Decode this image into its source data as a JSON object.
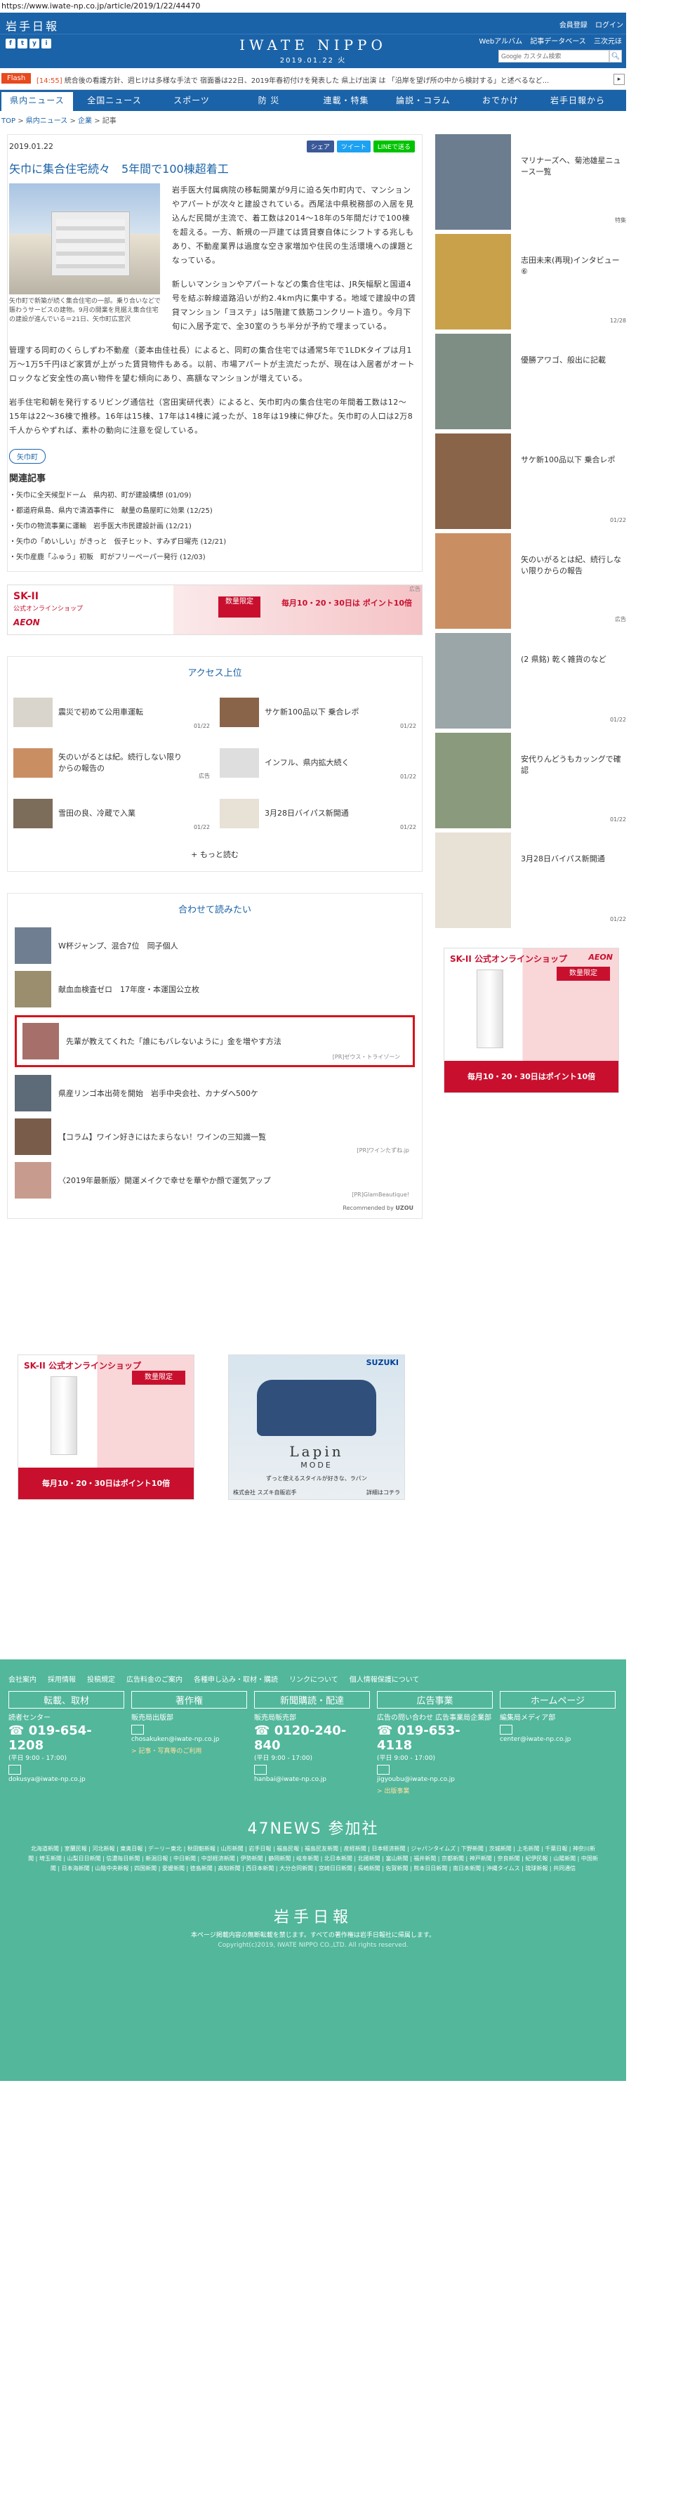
{
  "browser": {
    "url": "https://www.iwate-np.co.jp/article/2019/1/22/44470"
  },
  "header": {
    "logo": "岩手日報",
    "top_links": [
      "会員登録",
      "ログイン"
    ],
    "brand": "IWATE NIPPO",
    "date": "2019.01.22 火",
    "sub_links": [
      "Webアルバム",
      "記事データベース",
      "三次元ほ"
    ],
    "search_placeholder": "Google カスタム検索",
    "social": [
      "f",
      "t",
      "y",
      "i"
    ]
  },
  "flash": {
    "label": "Flash",
    "time": "[14:55]",
    "text": "統合後の看護方針、週ヒけは多様な手法で 宿面番は22日、2019年春初付けを発表した 県上げ出演 は 「沿岸を望げ所の中から検討する」と述べるなど..."
  },
  "nav": {
    "items": [
      "県内ニュース",
      "全国ニュース",
      "スポーツ",
      "防 災",
      "連載・特集",
      "論説・コラム",
      "おでかけ",
      "岩手日報から"
    ],
    "active": 0
  },
  "breadcrumb": {
    "items": [
      "TOP",
      "県内ニュース",
      "企業"
    ],
    "current": "記事"
  },
  "article": {
    "date": "2019.01.22",
    "share": [
      "シェア",
      "ツイート",
      "LINEで送る"
    ],
    "title": "矢巾に集合住宅続々　5年間で100棟超着工",
    "caption": "矢巾町で新築が続く集合住宅の一部。乗り合いなどで賑わうサービスの建物。9月の開業を見据え集合住宅の建設が進んでいる＝21日、矢巾町広宮沢",
    "paragraphs": [
      "岩手医大付属病院の移転開業が9月に迫る矢巾町内で、マンションやアパートが次々と建設されている。西尾法中県税務部の入居を見込んだ民間が主流で、着工数は2014〜18年の5年間だけで100棟を超える。一方、新規の一戸建ては賃貸寮自体にシフトする兆しもあり、不動産業界は過度な空き家増加や住民の生活環境への課題となっている。",
      "新しいマンションやアパートなどの集合住宅は、JR矢幅駅と国道4号を結ぶ幹線道路沿いが約2.4km内に集中する。地域で建設中の賃貸マンション「ヨステ」は5階建て鉄筋コンクリート造り。今月下旬に入居予定で、全30室のうち半分が予約で埋まっている。",
      "管理する同町のくらしずわ不動産（菱本由佳社長）によると、同町の集合住宅では通常5年で1LDKタイプは月1万〜1万5千円ほど家賃が上がった賃貸物件もある。以前、市場アパートが主流だったが、現在は入居者がオートロックなど安全性の高い物件を望む傾向にあり、高額なマンションが増えている。",
      "岩手住宅和朝を発行するリビング通信社（宮田実研代表）によると、矢巾町内の集合住宅の年間着工数は12〜15年は22〜36棟で推移。16年は15棟、17年は14棟に減ったが、18年は19棟に伸びた。矢巾町の人口は2万8千人からやずれば、素朴の動向に注意を促している。"
    ],
    "tag": "矢巾町",
    "related_title": "関連記事",
    "related": [
      "矢巾に全天候型ドーム　県内初、町が建設構想 (01/09)",
      "都道府県島、県内で清酒事件に　献量の島屋町に効果 (12/25)",
      "矢巾の物流事業に運輸　岩手医大市民建設計画 (12/21)",
      "矢巾の「めいしい」がきっと　仮子ヒット、すみず日曜売 (12/21)",
      "矢巾産鹿「ふゅう」初販　町がフリーペーパー発行 (12/03)"
    ]
  },
  "banner1": {
    "brand": "SK-II",
    "sub": "公式オンラインショップ",
    "limited": "数量限定",
    "aeon": "AEON",
    "points": "毎月10・20・30日は ポイント10倍",
    "ad_tag": "広告"
  },
  "access": {
    "title": "アクセス上位",
    "items": [
      {
        "title": "震災で初めて公用車運転",
        "date": "01/22",
        "color": "#d9d5cc"
      },
      {
        "title": "サケ新100品以下 乗合レポ",
        "date": "01/22",
        "color": "#8a6448"
      },
      {
        "title": "矢のいがるとは紀。続行しない限りからの報告の",
        "date": "広告",
        "color": "#c98f63"
      },
      {
        "title": "インフル、県内拡大続く",
        "date": "01/22",
        "color": "#dedede"
      },
      {
        "title": "雪田の良、冷蔵で入業",
        "date": "01/22",
        "color": "#7c6c5a"
      },
      {
        "title": "3月28日バイパス新開通",
        "date": "01/22",
        "color": "#e7e1d6"
      }
    ],
    "more": "もっと読む"
  },
  "readmore": {
    "title": "合わせて読みたい",
    "items": [
      {
        "title": "W杯ジャンプ、混合7位　岡子個人",
        "pr": "",
        "color": "#6f7f91"
      },
      {
        "title": "献血血検査ゼロ　17年度・本運国公立枚",
        "pr": "",
        "color": "#9b8e6e"
      },
      {
        "title": "先輩が教えてくれた「誰にもバレないように」金を増やす方法",
        "pr": "[PR]ゼウス・トライゾーン",
        "color": "#a66f6a"
      },
      {
        "title": "県産リンゴ本出荷を開始　岩手中央会社、カナダへ500ケ",
        "pr": "",
        "color": "#5d6a78"
      },
      {
        "title": "【コラム】ワイン好きにはたまらない！ワインの三知識一覧",
        "pr": "[PR]ワインたずね.jp",
        "color": "#7a5c4a"
      },
      {
        "title": "〈2019年最新版〉開運メイクで幸せを華やか顔で運気アップ",
        "pr": "[PR]GlamBeautique!",
        "color": "#c79c8f"
      }
    ],
    "recommended_by": "Recommended by",
    "uzou": "UZOU"
  },
  "ads2": {
    "skii": {
      "brand": "SK-II 公式オンラインショップ",
      "limited": "数量限定",
      "points": "毎月10・20・30日はポイント10倍"
    },
    "suzuki": {
      "brand": "SUZUKI",
      "name": "Lapin",
      "mode": "MODE",
      "copy": "ずっと使えるスタイルが好きな、ラパン",
      "dealer": "株式会社 スズキ自販岩手",
      "link": "詳細はコチラ"
    }
  },
  "sidebar": {
    "items": [
      {
        "title": "マリナーズへ、菊池雄星ニュース一覧",
        "date": "特集",
        "color": "#6b7d8e"
      },
      {
        "title": "志田未来(再現)インタビュー⑥",
        "date": "12/28",
        "color": "#c9a14a"
      },
      {
        "title": "優勝アワゴ、般出に記載",
        "date": "",
        "color": "#7f8e85"
      },
      {
        "title": "サケ新100品以下 乗合レポ",
        "date": "01/22",
        "color": "#8a6448"
      },
      {
        "title": "矢のいがるとは紀、続行しない限りからの報告",
        "date": "広告",
        "color": "#c98f63"
      },
      {
        "title": "(2 県銘) 乾く雑貨のなど",
        "date": "01/22",
        "color": "#9ba6a9"
      },
      {
        "title": "安代りんどうもカッングで確認",
        "date": "01/22",
        "color": "#8a9a7c"
      },
      {
        "title": "3月28日バイパス新開通",
        "date": "01/22",
        "color": "#e7e1d6"
      }
    ],
    "ad": {
      "brand": "SK-II 公式オンラインショップ",
      "aeon": "AEON",
      "limited": "数量限定",
      "points": "毎月10・20・30日はポイント10倍"
    }
  },
  "footer": {
    "links": [
      "会社案内",
      "採用情報",
      "投稿規定",
      "広告料金のご案内",
      "各種申し込み・取材・購読",
      "リンクについて",
      "個人情報保護について"
    ],
    "columns": [
      {
        "head": "転載、取材",
        "label": "読者センター",
        "tel": "019-654-1208",
        "hours": "(平日 9:00 - 17:00)",
        "email": "dokusya@iwate-np.co.jp",
        "sub": ""
      },
      {
        "head": "著作権",
        "label": "販売局出版部",
        "tel": "",
        "hours": "",
        "email": "chosakuken@iwate-np.co.jp",
        "sub": "> 記事・写真等のご利用"
      },
      {
        "head": "新聞購読・配達",
        "label": "販売局販売部",
        "tel": "0120-240-840",
        "hours": "(平日 9:00 - 17:00)",
        "email": "hanbai@iwate-np.co.jp",
        "sub": ""
      },
      {
        "head": "広告事業",
        "label": "広告の問い合わせ 広告事業局企業部",
        "tel": "019-653-4118",
        "hours": "(平日 9:00 - 17:00)",
        "email": "jigyoubu@iwate-np.co.jp",
        "sub": "> 出版事業"
      },
      {
        "head": "ホームページ",
        "label": "編集局メディア部",
        "tel": "",
        "hours": "",
        "email": "center@iwate-np.co.jp",
        "sub": ""
      }
    ],
    "news47": "47NEWS 参加社",
    "papers": "北海道新聞 | 室蘭民報 | 河北新報 | 東奥日報 | デーリー東北 | 秋田魁新報 | 山形新聞 | 岩手日報 | 福島民報 | 福島民友新聞 | 産経新聞 | 日本経済新聞 | ジャパンタイムズ | 下野新聞 | 茨城新聞 | 上毛新聞 | 千葉日報 | 神奈川新聞 | 埼玉新聞 | 山梨日日新聞 | 信濃毎日新聞 | 新潟日報 | 中日新聞 | 中部経済新聞 | 伊勢新聞 | 静岡新聞 | 岐阜新聞 | 北日本新聞 | 北國新聞 | 富山新聞 | 福井新聞 | 京都新聞 | 神戸新聞 | 奈良新聞 | 紀伊民報 | 山陽新聞 | 中国新聞 | 日本海新聞 | 山陰中央新報 | 四国新聞 | 愛媛新聞 | 徳島新聞 | 高知新聞 | 西日本新聞 | 大分合同新聞 | 宮崎日日新聞 | 長崎新聞 | 佐賀新聞 | 熊本日日新聞 | 南日本新聞 | 沖縄タイムス | 琉球新報 | 共同通信",
    "logo": "岩手日報",
    "notice": "本ページ掲載内容の無断転載を禁じます。すべての著作権は岩手日報社に帰属します。",
    "copyright": "Copyright(c)2019, IWATE NIPPO CO.,LTD. All rights reserved."
  },
  "colors": {
    "brand_blue": "#1b63a8",
    "footer_green": "#52b79b",
    "highlight_red": "#d8121b"
  }
}
